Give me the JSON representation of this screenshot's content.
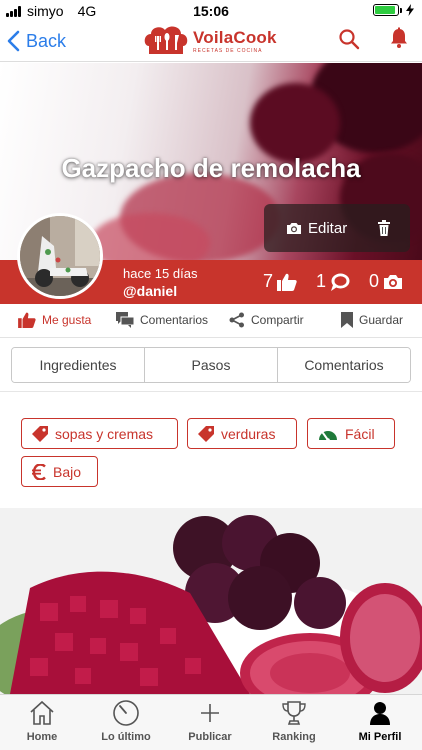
{
  "status_bar": {
    "carrier": "simyo",
    "network": "4G",
    "time": "15:06",
    "battery_fill": 0.9
  },
  "nav": {
    "back_label": "Back",
    "brand_name": "VoilaCook",
    "brand_tagline": "RECETAS DE COCINA"
  },
  "hero": {
    "title": "Gazpacho de remolacha",
    "edit_label": "Editar"
  },
  "author": {
    "time_ago": "hace 15 días",
    "username": "@daniel",
    "likes": "7",
    "comments": "1",
    "photos": "0"
  },
  "actions": {
    "like": "Me gusta",
    "comments": "Comentarios",
    "share": "Compartir",
    "save": "Guardar"
  },
  "tabs": [
    "Ingredientes",
    "Pasos",
    "Comentarios"
  ],
  "tags": {
    "category1": "sopas y cremas",
    "category2": "verduras",
    "difficulty": "Fácil",
    "cost": "Bajo"
  },
  "tabbar": {
    "home": "Home",
    "latest": "Lo último",
    "publish": "Publicar",
    "ranking": "Ranking",
    "profile": "Mi Perfil"
  },
  "colors": {
    "brand_red": "#c8342c",
    "ios_blue": "#2b7de9",
    "beet": "#7a1030"
  }
}
